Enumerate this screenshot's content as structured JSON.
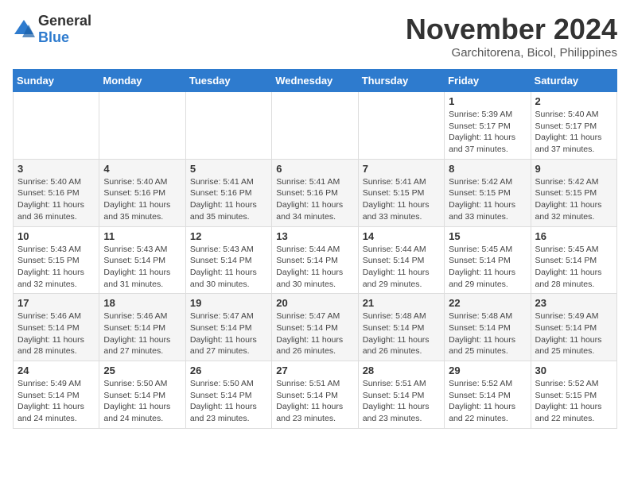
{
  "logo": {
    "text_general": "General",
    "text_blue": "Blue"
  },
  "title": "November 2024",
  "subtitle": "Garchitorena, Bicol, Philippines",
  "days_of_week": [
    "Sunday",
    "Monday",
    "Tuesday",
    "Wednesday",
    "Thursday",
    "Friday",
    "Saturday"
  ],
  "weeks": [
    [
      {
        "day": "",
        "info": ""
      },
      {
        "day": "",
        "info": ""
      },
      {
        "day": "",
        "info": ""
      },
      {
        "day": "",
        "info": ""
      },
      {
        "day": "",
        "info": ""
      },
      {
        "day": "1",
        "info": "Sunrise: 5:39 AM\nSunset: 5:17 PM\nDaylight: 11 hours and 37 minutes."
      },
      {
        "day": "2",
        "info": "Sunrise: 5:40 AM\nSunset: 5:17 PM\nDaylight: 11 hours and 37 minutes."
      }
    ],
    [
      {
        "day": "3",
        "info": "Sunrise: 5:40 AM\nSunset: 5:16 PM\nDaylight: 11 hours and 36 minutes."
      },
      {
        "day": "4",
        "info": "Sunrise: 5:40 AM\nSunset: 5:16 PM\nDaylight: 11 hours and 35 minutes."
      },
      {
        "day": "5",
        "info": "Sunrise: 5:41 AM\nSunset: 5:16 PM\nDaylight: 11 hours and 35 minutes."
      },
      {
        "day": "6",
        "info": "Sunrise: 5:41 AM\nSunset: 5:16 PM\nDaylight: 11 hours and 34 minutes."
      },
      {
        "day": "7",
        "info": "Sunrise: 5:41 AM\nSunset: 5:15 PM\nDaylight: 11 hours and 33 minutes."
      },
      {
        "day": "8",
        "info": "Sunrise: 5:42 AM\nSunset: 5:15 PM\nDaylight: 11 hours and 33 minutes."
      },
      {
        "day": "9",
        "info": "Sunrise: 5:42 AM\nSunset: 5:15 PM\nDaylight: 11 hours and 32 minutes."
      }
    ],
    [
      {
        "day": "10",
        "info": "Sunrise: 5:43 AM\nSunset: 5:15 PM\nDaylight: 11 hours and 32 minutes."
      },
      {
        "day": "11",
        "info": "Sunrise: 5:43 AM\nSunset: 5:14 PM\nDaylight: 11 hours and 31 minutes."
      },
      {
        "day": "12",
        "info": "Sunrise: 5:43 AM\nSunset: 5:14 PM\nDaylight: 11 hours and 30 minutes."
      },
      {
        "day": "13",
        "info": "Sunrise: 5:44 AM\nSunset: 5:14 PM\nDaylight: 11 hours and 30 minutes."
      },
      {
        "day": "14",
        "info": "Sunrise: 5:44 AM\nSunset: 5:14 PM\nDaylight: 11 hours and 29 minutes."
      },
      {
        "day": "15",
        "info": "Sunrise: 5:45 AM\nSunset: 5:14 PM\nDaylight: 11 hours and 29 minutes."
      },
      {
        "day": "16",
        "info": "Sunrise: 5:45 AM\nSunset: 5:14 PM\nDaylight: 11 hours and 28 minutes."
      }
    ],
    [
      {
        "day": "17",
        "info": "Sunrise: 5:46 AM\nSunset: 5:14 PM\nDaylight: 11 hours and 28 minutes."
      },
      {
        "day": "18",
        "info": "Sunrise: 5:46 AM\nSunset: 5:14 PM\nDaylight: 11 hours and 27 minutes."
      },
      {
        "day": "19",
        "info": "Sunrise: 5:47 AM\nSunset: 5:14 PM\nDaylight: 11 hours and 27 minutes."
      },
      {
        "day": "20",
        "info": "Sunrise: 5:47 AM\nSunset: 5:14 PM\nDaylight: 11 hours and 26 minutes."
      },
      {
        "day": "21",
        "info": "Sunrise: 5:48 AM\nSunset: 5:14 PM\nDaylight: 11 hours and 26 minutes."
      },
      {
        "day": "22",
        "info": "Sunrise: 5:48 AM\nSunset: 5:14 PM\nDaylight: 11 hours and 25 minutes."
      },
      {
        "day": "23",
        "info": "Sunrise: 5:49 AM\nSunset: 5:14 PM\nDaylight: 11 hours and 25 minutes."
      }
    ],
    [
      {
        "day": "24",
        "info": "Sunrise: 5:49 AM\nSunset: 5:14 PM\nDaylight: 11 hours and 24 minutes."
      },
      {
        "day": "25",
        "info": "Sunrise: 5:50 AM\nSunset: 5:14 PM\nDaylight: 11 hours and 24 minutes."
      },
      {
        "day": "26",
        "info": "Sunrise: 5:50 AM\nSunset: 5:14 PM\nDaylight: 11 hours and 23 minutes."
      },
      {
        "day": "27",
        "info": "Sunrise: 5:51 AM\nSunset: 5:14 PM\nDaylight: 11 hours and 23 minutes."
      },
      {
        "day": "28",
        "info": "Sunrise: 5:51 AM\nSunset: 5:14 PM\nDaylight: 11 hours and 23 minutes."
      },
      {
        "day": "29",
        "info": "Sunrise: 5:52 AM\nSunset: 5:14 PM\nDaylight: 11 hours and 22 minutes."
      },
      {
        "day": "30",
        "info": "Sunrise: 5:52 AM\nSunset: 5:15 PM\nDaylight: 11 hours and 22 minutes."
      }
    ]
  ]
}
